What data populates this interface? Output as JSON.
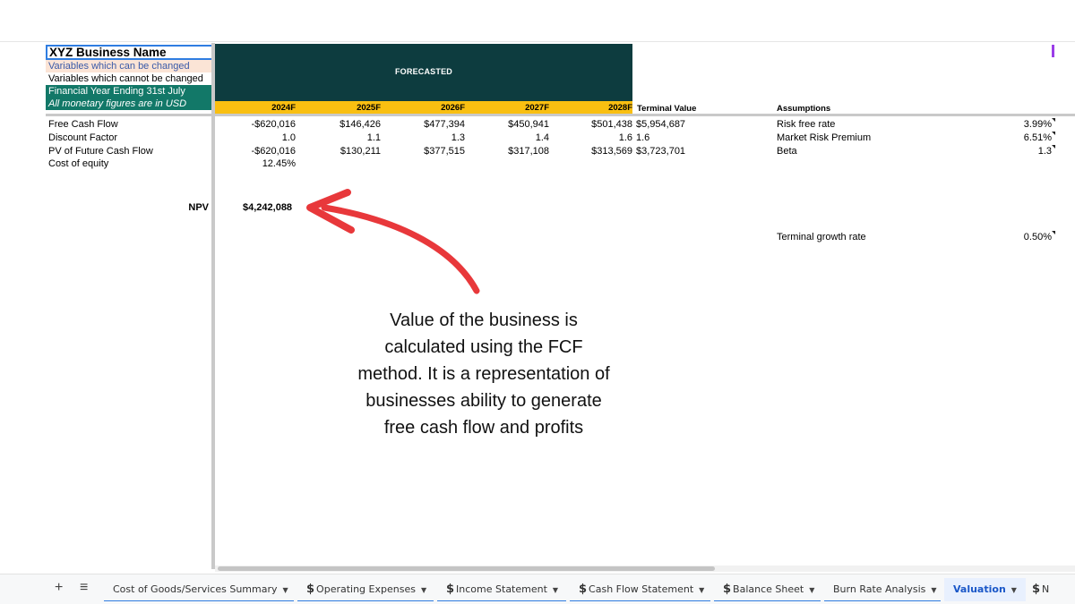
{
  "legend": {
    "business_name": "XYZ Business Name",
    "changeable": "Variables which can be changed",
    "fixed": "Variables which cannot be changed",
    "fy": "Financial Year Ending 31st July",
    "currency": "All monetary figures are in USD"
  },
  "forecast": {
    "label": "FORECASTED",
    "years": [
      "2024F",
      "2025F",
      "2026F",
      "2027F",
      "2028F"
    ],
    "terminal_header": "Terminal Value",
    "assumptions_header": "Assumptions"
  },
  "rows": {
    "fcf": {
      "label": "Free Cash Flow",
      "values": [
        "-$620,016",
        "$146,426",
        "$477,394",
        "$450,941",
        "$501,438"
      ],
      "terminal": "$5,954,687"
    },
    "discount": {
      "label": "Discount Factor",
      "values": [
        "1.0",
        "1.1",
        "1.3",
        "1.4",
        "1.6"
      ],
      "terminal": "1.6"
    },
    "pv": {
      "label": "PV of Future Cash Flow",
      "values": [
        "-$620,016",
        "$130,211",
        "$377,515",
        "$317,108",
        "$313,569"
      ],
      "terminal": "$3,723,701"
    },
    "coe": {
      "label": "Cost of equity",
      "value": "12.45%"
    }
  },
  "npv": {
    "label": "NPV",
    "value": "$4,242,088"
  },
  "assumptions": [
    {
      "label": "Risk free rate",
      "value": "3.99%"
    },
    {
      "label": "Market Risk Premium",
      "value": "6.51%"
    },
    {
      "label": "Beta",
      "value": "1.3"
    },
    {
      "label": "Terminal growth rate",
      "value": "0.50%"
    }
  ],
  "annotation": "Value of the business is calculated using the FCF method. It is a representation of businesses ability to generate free cash flow and profits",
  "tabs": {
    "add": "+",
    "menu": "≡",
    "items": [
      {
        "label": "Cost of Goods/Services Summary",
        "dollar": ""
      },
      {
        "label": "Operating Expenses",
        "dollar": "$"
      },
      {
        "label": "Income Statement",
        "dollar": "$"
      },
      {
        "label": "Cash Flow Statement",
        "dollar": "$"
      },
      {
        "label": "Balance Sheet",
        "dollar": "$"
      },
      {
        "label": "Burn Rate Analysis",
        "dollar": ""
      },
      {
        "label": "Valuation",
        "dollar": ""
      },
      {
        "label": "N",
        "dollar": "$"
      }
    ]
  },
  "colors": {
    "forecast_band": "#0d3c3f",
    "year_band": "#f9bf11",
    "legend_teal": "#127868",
    "legend_peach": "#fbe4d6",
    "arrow": "#e8383b",
    "active_tab": "#1a57c8"
  },
  "icons": {
    "tab_caret": "caret-down-icon",
    "dollar": "dollar-icon",
    "arrow": "curved-arrow-icon"
  }
}
